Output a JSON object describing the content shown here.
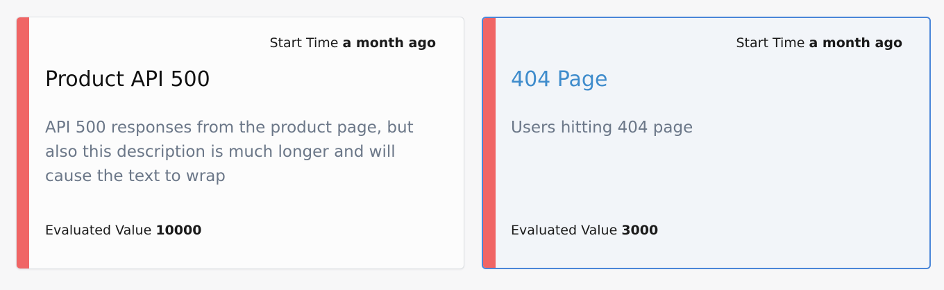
{
  "alerts": [
    {
      "start_time_label": "Start Time",
      "start_time_value": "a month ago",
      "title": "Product API 500",
      "description": "API 500 responses from the product page, but also this description is much longer and will cause the text to wrap",
      "evaluated_label": "Evaluated Value",
      "evaluated_value": "10000",
      "status_color": "#f06565",
      "selected": false
    },
    {
      "start_time_label": "Start Time",
      "start_time_value": "a month ago",
      "title": "404 Page",
      "description": "Users hitting 404 page",
      "evaluated_label": "Evaluated Value",
      "evaluated_value": "3000",
      "status_color": "#f06565",
      "selected": true,
      "selected_border_color": "#4a86d8",
      "title_color": "#3f8ccc"
    }
  ]
}
